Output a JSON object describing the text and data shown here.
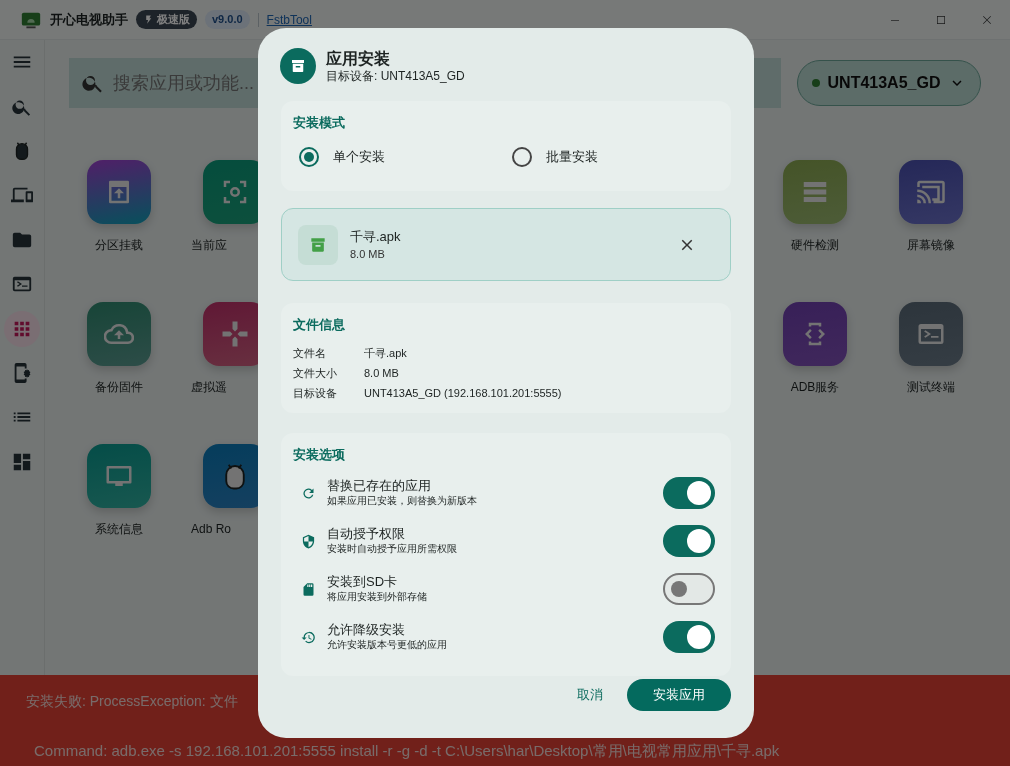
{
  "title_bar": {
    "app_name": "开心电视助手",
    "edition_badge": "极速版",
    "version": "v9.0.0",
    "tool_link": "FstbTool"
  },
  "sidebar": {
    "items": [
      {
        "selected": false
      },
      {
        "selected": false
      },
      {
        "selected": false
      },
      {
        "selected": false
      },
      {
        "selected": false
      },
      {
        "selected": false
      },
      {
        "selected": true
      },
      {
        "selected": false
      },
      {
        "selected": false
      },
      {
        "selected": false
      }
    ]
  },
  "search": {
    "placeholder": "搜索应用或功能..."
  },
  "device": {
    "name": "UNT413A5_GD",
    "connected": true
  },
  "app_rows": [
    {
      "left": [
        {
          "label": "分区挂载"
        },
        {
          "label": "当前应"
        }
      ],
      "right": [
        {
          "label": "硬件检测"
        },
        {
          "label": "屏幕镜像"
        }
      ]
    },
    {
      "left": [
        {
          "label": "备份固件"
        },
        {
          "label": "虚拟遥"
        }
      ],
      "right": [
        {
          "label": "ADB服务"
        },
        {
          "label": "测试终端"
        }
      ]
    },
    {
      "left": [
        {
          "label": "系统信息"
        },
        {
          "label": "Adb Ro"
        }
      ],
      "right": []
    }
  ],
  "error_bar": {
    "message": "安装失败: ProcessException: 文件",
    "command": "Command: adb.exe -s 192.168.101.201:5555 install -r -g -d -t C:\\Users\\har\\Desktop\\常用\\电视常用应用\\千寻.apk"
  },
  "dialog": {
    "title": "应用安装",
    "subtitle": "目标设备: UNT413A5_GD",
    "mode": {
      "heading": "安装模式",
      "options": [
        {
          "label": "单个安装",
          "selected": true
        },
        {
          "label": "批量安装",
          "selected": false
        }
      ]
    },
    "file": {
      "name": "千寻.apk",
      "size": "8.0 MB"
    },
    "info": {
      "heading": "文件信息",
      "rows": [
        {
          "label": "文件名",
          "value": "千寻.apk"
        },
        {
          "label": "文件大小",
          "value": "8.0 MB"
        },
        {
          "label": "目标设备",
          "value": "UNT413A5_GD (192.168.101.201:5555)"
        }
      ]
    },
    "options": {
      "heading": "安装选项",
      "items": [
        {
          "title": "替换已存在的应用",
          "description": "如果应用已安装，则替换为新版本",
          "on": true
        },
        {
          "title": "自动授予权限",
          "description": "安装时自动授予应用所需权限",
          "on": true
        },
        {
          "title": "安装到SD卡",
          "description": "将应用安装到外部存储",
          "on": false
        },
        {
          "title": "允许降级安装",
          "description": "允许安装版本号更低的应用",
          "on": true
        }
      ]
    },
    "buttons": {
      "cancel": "取消",
      "confirm": "安装应用"
    }
  }
}
